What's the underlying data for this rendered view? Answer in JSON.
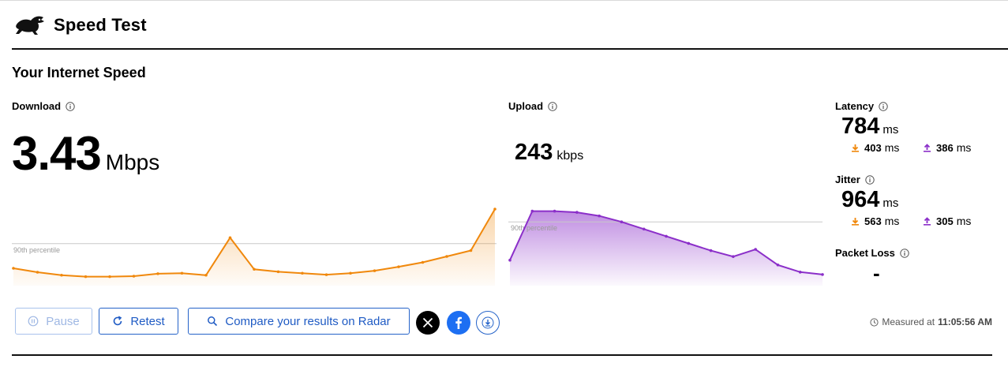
{
  "header": {
    "title": "Speed Test",
    "logo_icon": "rabbit-icon"
  },
  "section_title": "Your Internet Speed",
  "download": {
    "label": "Download",
    "value": "3.43",
    "unit": "Mbps",
    "percentile_label": "90th percentile",
    "color": "#f0880c"
  },
  "upload": {
    "label": "Upload",
    "value": "243",
    "unit": "kbps",
    "percentile_label": "90th percentile",
    "color": "#8b2fc9"
  },
  "latency": {
    "label": "Latency",
    "value": "784",
    "unit": "ms",
    "down_value": "403",
    "down_unit": "ms",
    "up_value": "386",
    "up_unit": "ms"
  },
  "jitter": {
    "label": "Jitter",
    "value": "964",
    "unit": "ms",
    "down_value": "563",
    "down_unit": "ms",
    "up_value": "305",
    "up_unit": "ms"
  },
  "packet_loss": {
    "label": "Packet Loss",
    "value": "-"
  },
  "actions": {
    "pause_label": "Pause",
    "retest_label": "Retest",
    "compare_label": "Compare your results on Radar",
    "share_x_icon": "x-logo-icon",
    "share_facebook_icon": "facebook-icon",
    "download_icon": "download-icon"
  },
  "measured": {
    "prefix": "Measured at",
    "time": "11:05:56 AM"
  },
  "chart_data": [
    {
      "type": "area",
      "name": "download",
      "x": [
        0,
        1,
        2,
        3,
        4,
        5,
        6,
        7,
        8,
        9,
        10,
        11,
        12,
        13,
        14,
        15,
        16,
        17,
        18,
        19,
        20
      ],
      "values": [
        1.6,
        1.2,
        0.9,
        0.75,
        0.75,
        0.8,
        1.05,
        1.1,
        0.9,
        4.7,
        1.5,
        1.25,
        1.1,
        0.95,
        1.1,
        1.35,
        1.75,
        2.2,
        2.8,
        3.4,
        7.6
      ],
      "ylim": [
        0,
        8
      ],
      "reference_line": 4.1
    },
    {
      "type": "area",
      "name": "upload",
      "x": [
        0,
        1,
        2,
        3,
        4,
        5,
        6,
        7,
        8,
        9,
        10,
        11,
        12,
        13,
        14
      ],
      "values": [
        0.2,
        0.61,
        0.61,
        0.6,
        0.57,
        0.52,
        0.46,
        0.4,
        0.34,
        0.28,
        0.23,
        0.29,
        0.16,
        0.1,
        0.08
      ],
      "ylim": [
        0,
        0.66
      ],
      "reference_line": 0.52
    }
  ]
}
